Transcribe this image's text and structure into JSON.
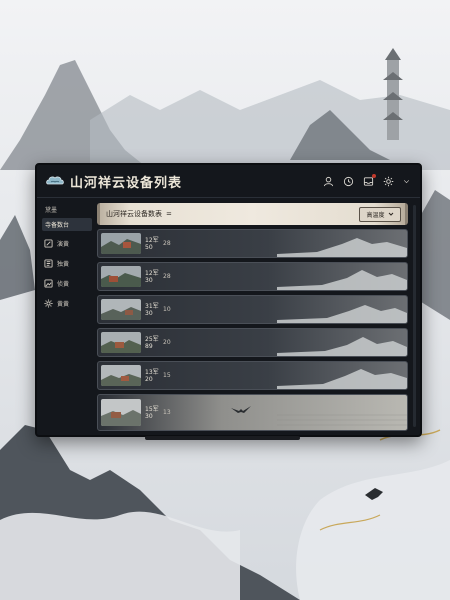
{
  "app": {
    "title": "山河祥云设备列表"
  },
  "icons": {
    "logo": "cloud-logo-icon",
    "user": "user-icon",
    "history": "clock-icon",
    "notifications": "inbox-icon",
    "settings": "gear-icon"
  },
  "sidebar": {
    "header": "黛墨",
    "items": [
      {
        "label": "寺备数台",
        "icon": "",
        "active": true
      },
      {
        "label": "演黄",
        "icon": "edit-icon"
      },
      {
        "label": "独黄",
        "icon": "media-icon"
      },
      {
        "label": "侦黄",
        "icon": "image-icon"
      },
      {
        "label": "黄黄",
        "icon": "gear-icon"
      }
    ]
  },
  "banner": {
    "title": "山河祥云设备数表",
    "suffix": "=",
    "sort_label": "高温度"
  },
  "devices": [
    {
      "line1": "12军",
      "line2": "50",
      "extra": "28"
    },
    {
      "line1": "12军",
      "line2": "30",
      "extra": "28"
    },
    {
      "line1": "31军",
      "line2": "30",
      "extra": "10"
    },
    {
      "line1": "25军",
      "line2": "89",
      "extra": "20"
    },
    {
      "line1": "13军",
      "line2": "20",
      "extra": "15"
    },
    {
      "line1": "15军",
      "line2": "30",
      "extra": "13"
    }
  ],
  "colors": {
    "window_bg": "#14171c",
    "banner": "#efe9df",
    "text": "#d9d6cf"
  }
}
